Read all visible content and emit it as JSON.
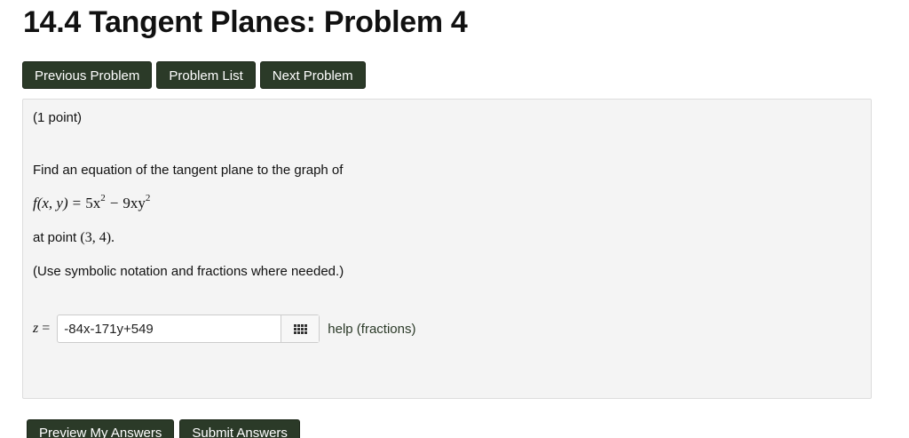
{
  "page": {
    "title": "14.4 Tangent Planes: Problem 4"
  },
  "nav": {
    "previous_label": "Previous Problem",
    "list_label": "Problem List",
    "next_label": "Next Problem"
  },
  "problem": {
    "points": "(1 point)",
    "prompt": "Find an equation of the tangent plane to the graph of",
    "function_lhs": "f(x, y)",
    "function_eq": "=",
    "function_term1": "5x",
    "function_term1_exp": "2",
    "function_minus": "−",
    "function_term2": "9xy",
    "function_term2_exp": "2",
    "at_point_text": "at point",
    "point": "(3,  4).",
    "instruction": "(Use symbolic notation and fractions where needed.)"
  },
  "answer": {
    "label_var": "z",
    "label_eq": "=",
    "value": "-84x-171y+549",
    "keypad_icon": "keypad-grid-icon",
    "help_label": "help (fractions)"
  },
  "actions": {
    "preview_label": "Preview My Answers",
    "submit_label": "Submit Answers"
  },
  "colors": {
    "button_bg": "#2b3a28",
    "panel_bg": "#f4f4f4",
    "link": "#2b3a28"
  }
}
